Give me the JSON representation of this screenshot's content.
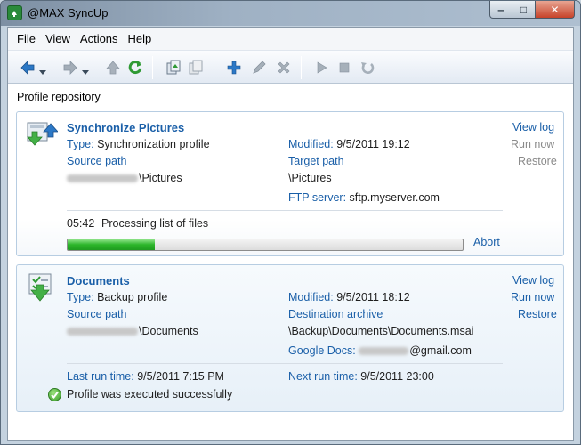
{
  "window": {
    "title": "@MAX SyncUp",
    "controls": {
      "minimize": "‒",
      "maximize": "□",
      "close": "✕"
    }
  },
  "menu": [
    "File",
    "View",
    "Actions",
    "Help"
  ],
  "toolbar": {
    "icons": [
      "back-arrow-icon",
      "forward-arrow-icon",
      "up-arrow-icon",
      "refresh-icon",
      "copy-profile-icon",
      "paste-profile-icon",
      "add-icon",
      "edit-icon",
      "delete-icon",
      "run-icon",
      "stop-icon",
      "restore-icon"
    ]
  },
  "section_label": "Profile repository",
  "profiles": [
    {
      "name": "Synchronize Pictures",
      "type_label": "Type:",
      "type_value": "Synchronization profile",
      "modified_label": "Modified:",
      "modified_value": "9/5/2011 19:12",
      "source_label": "Source path",
      "source_value": "\\Pictures",
      "target_label": "Target path",
      "target_value": "\\Pictures",
      "ftp_label": "FTP server:",
      "ftp_value": "sftp.myserver.com",
      "progress_time": "05:42",
      "progress_text": "Processing list of files",
      "progress_fraction": 0.22,
      "abort": "Abort",
      "actions": {
        "view_log": "View log",
        "run_now": "Run now",
        "restore": "Restore"
      }
    },
    {
      "name": "Documents",
      "type_label": "Type:",
      "type_value": "Backup profile",
      "modified_label": "Modified:",
      "modified_value": "9/5/2011 18:12",
      "source_label": "Source path",
      "source_value": "\\Documents",
      "dest_label": "Destination archive",
      "dest_value": "\\Backup\\Documents\\Documents.msai",
      "gdocs_label": "Google Docs:",
      "gdocs_value": "@gmail.com",
      "last_run_label": "Last run time:",
      "last_run_value": "9/5/2011 7:15 PM",
      "next_run_label": "Next run time:",
      "next_run_value": "9/5/2011 23:00",
      "status": "Profile was executed successfully",
      "actions": {
        "view_log": "View log",
        "run_now": "Run now",
        "restore": "Restore"
      }
    }
  ],
  "colors": {
    "link": "#1a5fa8",
    "progress": "#2cb52a",
    "accent_icon": "#2f9a34"
  }
}
